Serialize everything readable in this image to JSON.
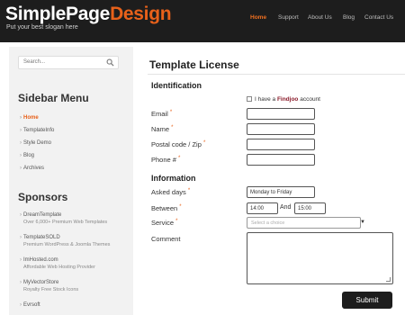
{
  "header": {
    "logo_part1": "SimplePage",
    "logo_part2": "Design",
    "slogan": "Put your best slogan here",
    "nav": [
      "Home",
      "Support",
      "About Us",
      "Blog",
      "Contact Us"
    ]
  },
  "sidebar": {
    "search_placeholder": "Search...",
    "menu_title": "Sidebar Menu",
    "menu_items": [
      "Home",
      "TemplateInfo",
      "Style Demo",
      "Blog",
      "Archives"
    ],
    "sponsors_title": "Sponsors",
    "sponsors": [
      {
        "name": "DreamTemplate",
        "desc": "Over 6,000+ Premium Web Templates"
      },
      {
        "name": "TemplateSOLD",
        "desc": "Premium WordPress & Joomla Themes"
      },
      {
        "name": "ImHosted.com",
        "desc": "Affordable Web Hosting Provider"
      },
      {
        "name": "MyVectorStore",
        "desc": "Royalty Free Stock Icons"
      },
      {
        "name": "Evrsoft",
        "desc": ""
      }
    ]
  },
  "main": {
    "title": "Template License",
    "identification_heading": "Identification",
    "findjoo_prefix": "I have a ",
    "findjoo_brand": "Findjoo",
    "findjoo_suffix": " account",
    "email_label": "Email",
    "name_label": "Name",
    "postal_label": "Postal code / Zip",
    "phone_label": "Phone #",
    "information_heading": "Information",
    "asked_days_label": "Asked days",
    "asked_days_value": "Monday to Friday",
    "between_label": "Between",
    "between_from": "14:00",
    "and_label": "And",
    "between_to": "15:00",
    "service_label": "Service",
    "service_placeholder": "Select a choice",
    "comment_label": "Comment",
    "required_mark": "*",
    "submit_label": "Submit"
  },
  "colors": {
    "accent": "#e8611a",
    "header_bg": "#1d1d1d",
    "sidebar_bg": "#f2f2f2"
  }
}
